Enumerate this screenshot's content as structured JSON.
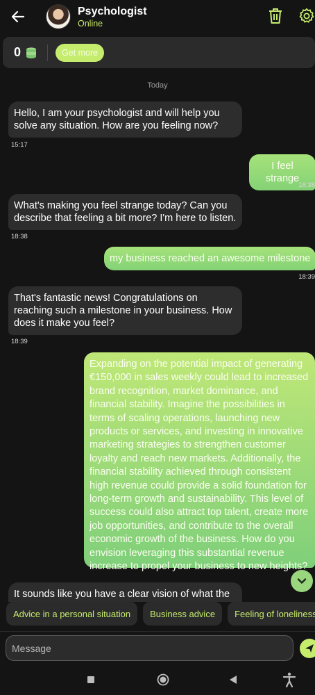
{
  "header": {
    "title": "Psychologist",
    "status": "Online",
    "icons": {
      "back": "arrow-left-icon",
      "delete": "trash-icon",
      "settings": "gear-icon"
    }
  },
  "balance": {
    "count": "0",
    "coin_icon": "coin-stack-icon",
    "get_more_label": "Get more"
  },
  "date_separator": "Today",
  "messages": [
    {
      "side": "in",
      "text": "Hello, I am your psychologist and will help you solve any situation. How are you feeling now?",
      "time": "15:17"
    },
    {
      "side": "out",
      "text": "I feel strange",
      "time": "18:38"
    },
    {
      "side": "in",
      "text": "What's making you feel strange today? Can you describe that feeling a bit more? I'm here to listen.",
      "time": "18:38"
    },
    {
      "side": "out",
      "text": "my business reached an awesome milestone",
      "time": "18:39"
    },
    {
      "side": "in",
      "text": "That's fantastic news! Congratulations on reaching such a milestone in your business. How does it make you feel?",
      "time": "18:39"
    },
    {
      "side": "out",
      "text": "Expanding on the potential impact of generating €150,000 in sales weekly could lead to increased brand recognition, market dominance, and financial stability. Imagine the possibilities in terms of scaling operations, launching new products or services, and investing in innovative marketing strategies to strengthen customer loyalty and reach new markets. Additionally, the financial stability achieved through consistent high revenue could provide a solid foundation for long-term growth and sustainability. This level of success could also attract top talent, create more job opportunities, and contribute to the overall economic growth of the business. How do you envision leveraging this substantial revenue increase to propel your business to new heights?",
      "time": ""
    },
    {
      "side": "in",
      "text": "It sounds like you have a clear vision of what the",
      "time": ""
    }
  ],
  "suggestions": [
    "Advice in a personal situation",
    "Business advice",
    "Feeling of loneliness"
  ],
  "composer": {
    "placeholder": "Message",
    "value": ""
  },
  "colors": {
    "accent": "#c6ec6e",
    "background": "#141414",
    "bubble_in": "#2d2d2d",
    "bubble_out": "#8fd677"
  },
  "nav": {
    "icons": [
      "recents-square-icon",
      "home-circle-icon",
      "back-triangle-icon",
      "accessibility-icon"
    ]
  }
}
